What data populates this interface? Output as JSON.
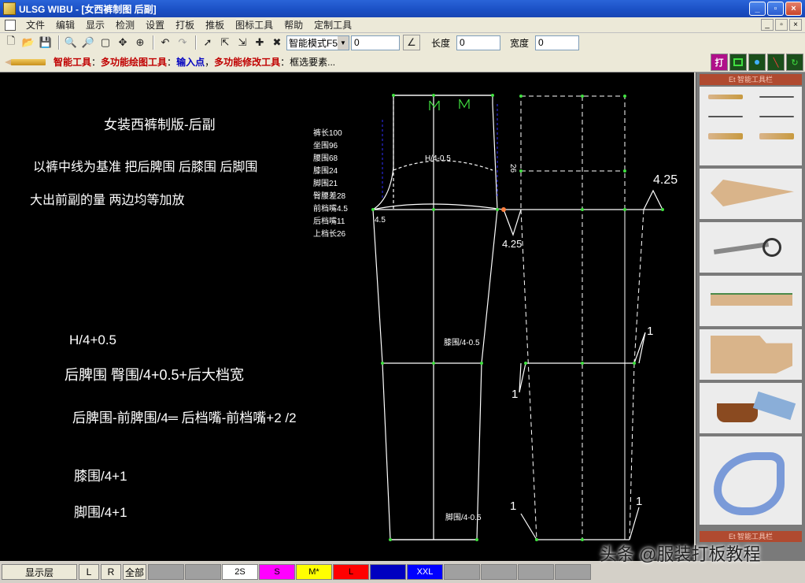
{
  "titlebar": {
    "title": "ULSG WIBU - [女西裤制图 后副]",
    "btn_min": "_",
    "btn_max": "▫",
    "btn_close": "×"
  },
  "menu": [
    "文件",
    "编辑",
    "显示",
    "检测",
    "设置",
    "打板",
    "推板",
    "图标工具",
    "帮助",
    "定制工具"
  ],
  "mdi": {
    "min": "_",
    "max": "▫",
    "close": "×"
  },
  "toolbar": {
    "mode": "智能模式F5",
    "value1": "0",
    "length_label": "长度",
    "length_value": "0",
    "width_label": "宽度",
    "width_value": "0"
  },
  "smartbar": {
    "smart_tool": "智能工具",
    "draw_tool": "多功能绘图工具",
    "input_point": "输入点",
    "modify_tool": "多功能修改工具",
    "select": "框选要素..."
  },
  "canvas": {
    "title": "女装西裤制版-后副",
    "line1": "以裤中线为基准   把后脾围   后膝围   后脚围",
    "line2": "大出前副的量   两边均等加放",
    "h4": "H/4+0.5",
    "hip": "后脾围    臀围/4+0.5+后大档宽",
    "formula": "后脾围-前脾围/4═    后档嘴-前档嘴+2    /2",
    "knee": "膝围/4+1",
    "foot": "脚围/4+1",
    "measures": [
      "裤长100",
      "坐围96",
      "腰围68",
      "膝围24",
      "脚围21",
      "臀腰差28",
      "前档嘴4.5",
      "后档嘴11",
      "上档长26"
    ],
    "h4_label": "H/4-0.5",
    "knee_label": "膝围/4-0.5",
    "foot_label": "脚围/4-0.5",
    "v45": "4.5",
    "v26": "26",
    "v425a": "4.25",
    "v425b": "4.25",
    "one_a": "1",
    "one_b": "1",
    "one_c": "1",
    "one_d": "1"
  },
  "panel": {
    "head1": "Et 智能工具栏",
    "head2": "Et 智能工具栏"
  },
  "statusbar": {
    "layers": "显示层",
    "l": "L",
    "r": "R",
    "all": "全部",
    "sizes": [
      {
        "label": "",
        "color": "#a0a0a0"
      },
      {
        "label": "",
        "color": "#a0a0a0"
      },
      {
        "label": "2S",
        "color": "#ffffff"
      },
      {
        "label": "S",
        "color": "#ff00ff"
      },
      {
        "label": "M*",
        "color": "#ffff00"
      },
      {
        "label": "L",
        "color": "#ff0000"
      },
      {
        "label": "",
        "color": "#0000c0"
      },
      {
        "label": "XXL",
        "color": "#0000ff"
      },
      {
        "label": "",
        "color": "#a0a0a0"
      },
      {
        "label": "",
        "color": "#a0a0a0"
      },
      {
        "label": "",
        "color": "#a0a0a0"
      },
      {
        "label": "",
        "color": "#a0a0a0"
      }
    ]
  },
  "watermark": "头条 @服装打板教程"
}
